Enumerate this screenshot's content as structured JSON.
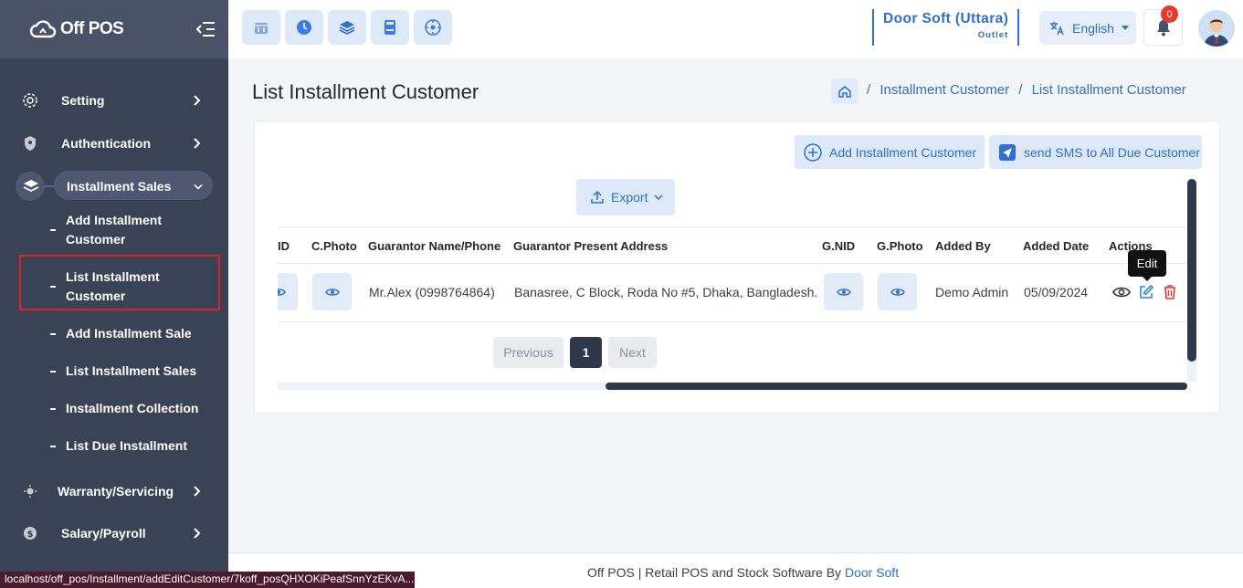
{
  "sidebar": {
    "logo_text": "Off POS",
    "menu": [
      {
        "label": "Setting",
        "icon": "gear-icon"
      },
      {
        "label": "Authentication",
        "icon": "shield-icon"
      },
      {
        "label": "Installment Sales",
        "icon": "layers-icon"
      },
      {
        "label": "Warranty/Servicing",
        "icon": "bulb-icon"
      },
      {
        "label": "Salary/Payroll",
        "icon": "dollar-icon"
      }
    ],
    "submenu": [
      {
        "label": "Add Installment Customer"
      },
      {
        "label": "List Installment Customer"
      },
      {
        "label": "Add Installment Sale"
      },
      {
        "label": "List Installment Sales"
      },
      {
        "label": "Installment Collection"
      },
      {
        "label": "List Due Installment"
      }
    ]
  },
  "header": {
    "company_name": "Door Soft (Uttara)",
    "company_sub": "Outlet",
    "language": "English",
    "notification_count": "0",
    "quick_icons": [
      "store-icon",
      "clock-icon",
      "layers-icon",
      "calculator-icon",
      "dashboard-icon"
    ]
  },
  "page": {
    "title": "List Installment Customer",
    "breadcrumb": [
      "Installment Customer",
      "List Installment Customer"
    ],
    "add_button": "Add Installment Customer",
    "sms_button": "send SMS to All Due Customer",
    "export_button": "Export"
  },
  "table": {
    "columns": [
      "ID",
      "C.Photo",
      "Guarantor Name/Phone",
      "Guarantor Present Address",
      "G.NID",
      "G.Photo",
      "Added By",
      "Added Date",
      "Actions"
    ],
    "rows": [
      {
        "guarantor": "Mr.Alex (0998764864)",
        "address": "Banasree, C Block, Roda No #5, Dhaka, Bangladesh.",
        "added_by": "Demo Admin",
        "added_date": "05/09/2024"
      }
    ],
    "tooltip": "Edit"
  },
  "pagination": {
    "previous": "Previous",
    "current": "1",
    "next": "Next"
  },
  "footer": {
    "text": "Off POS | Retail POS and Stock Software By",
    "link": "Door Soft"
  },
  "status_url": "localhost/off_pos/Installment/addEditCustomer/7koff_posQHXOKiPeafSnnYzEKvA...",
  "colors": {
    "sidebar": "#3a4256",
    "accent": "#2e6fd2",
    "danger": "#e63a31"
  }
}
